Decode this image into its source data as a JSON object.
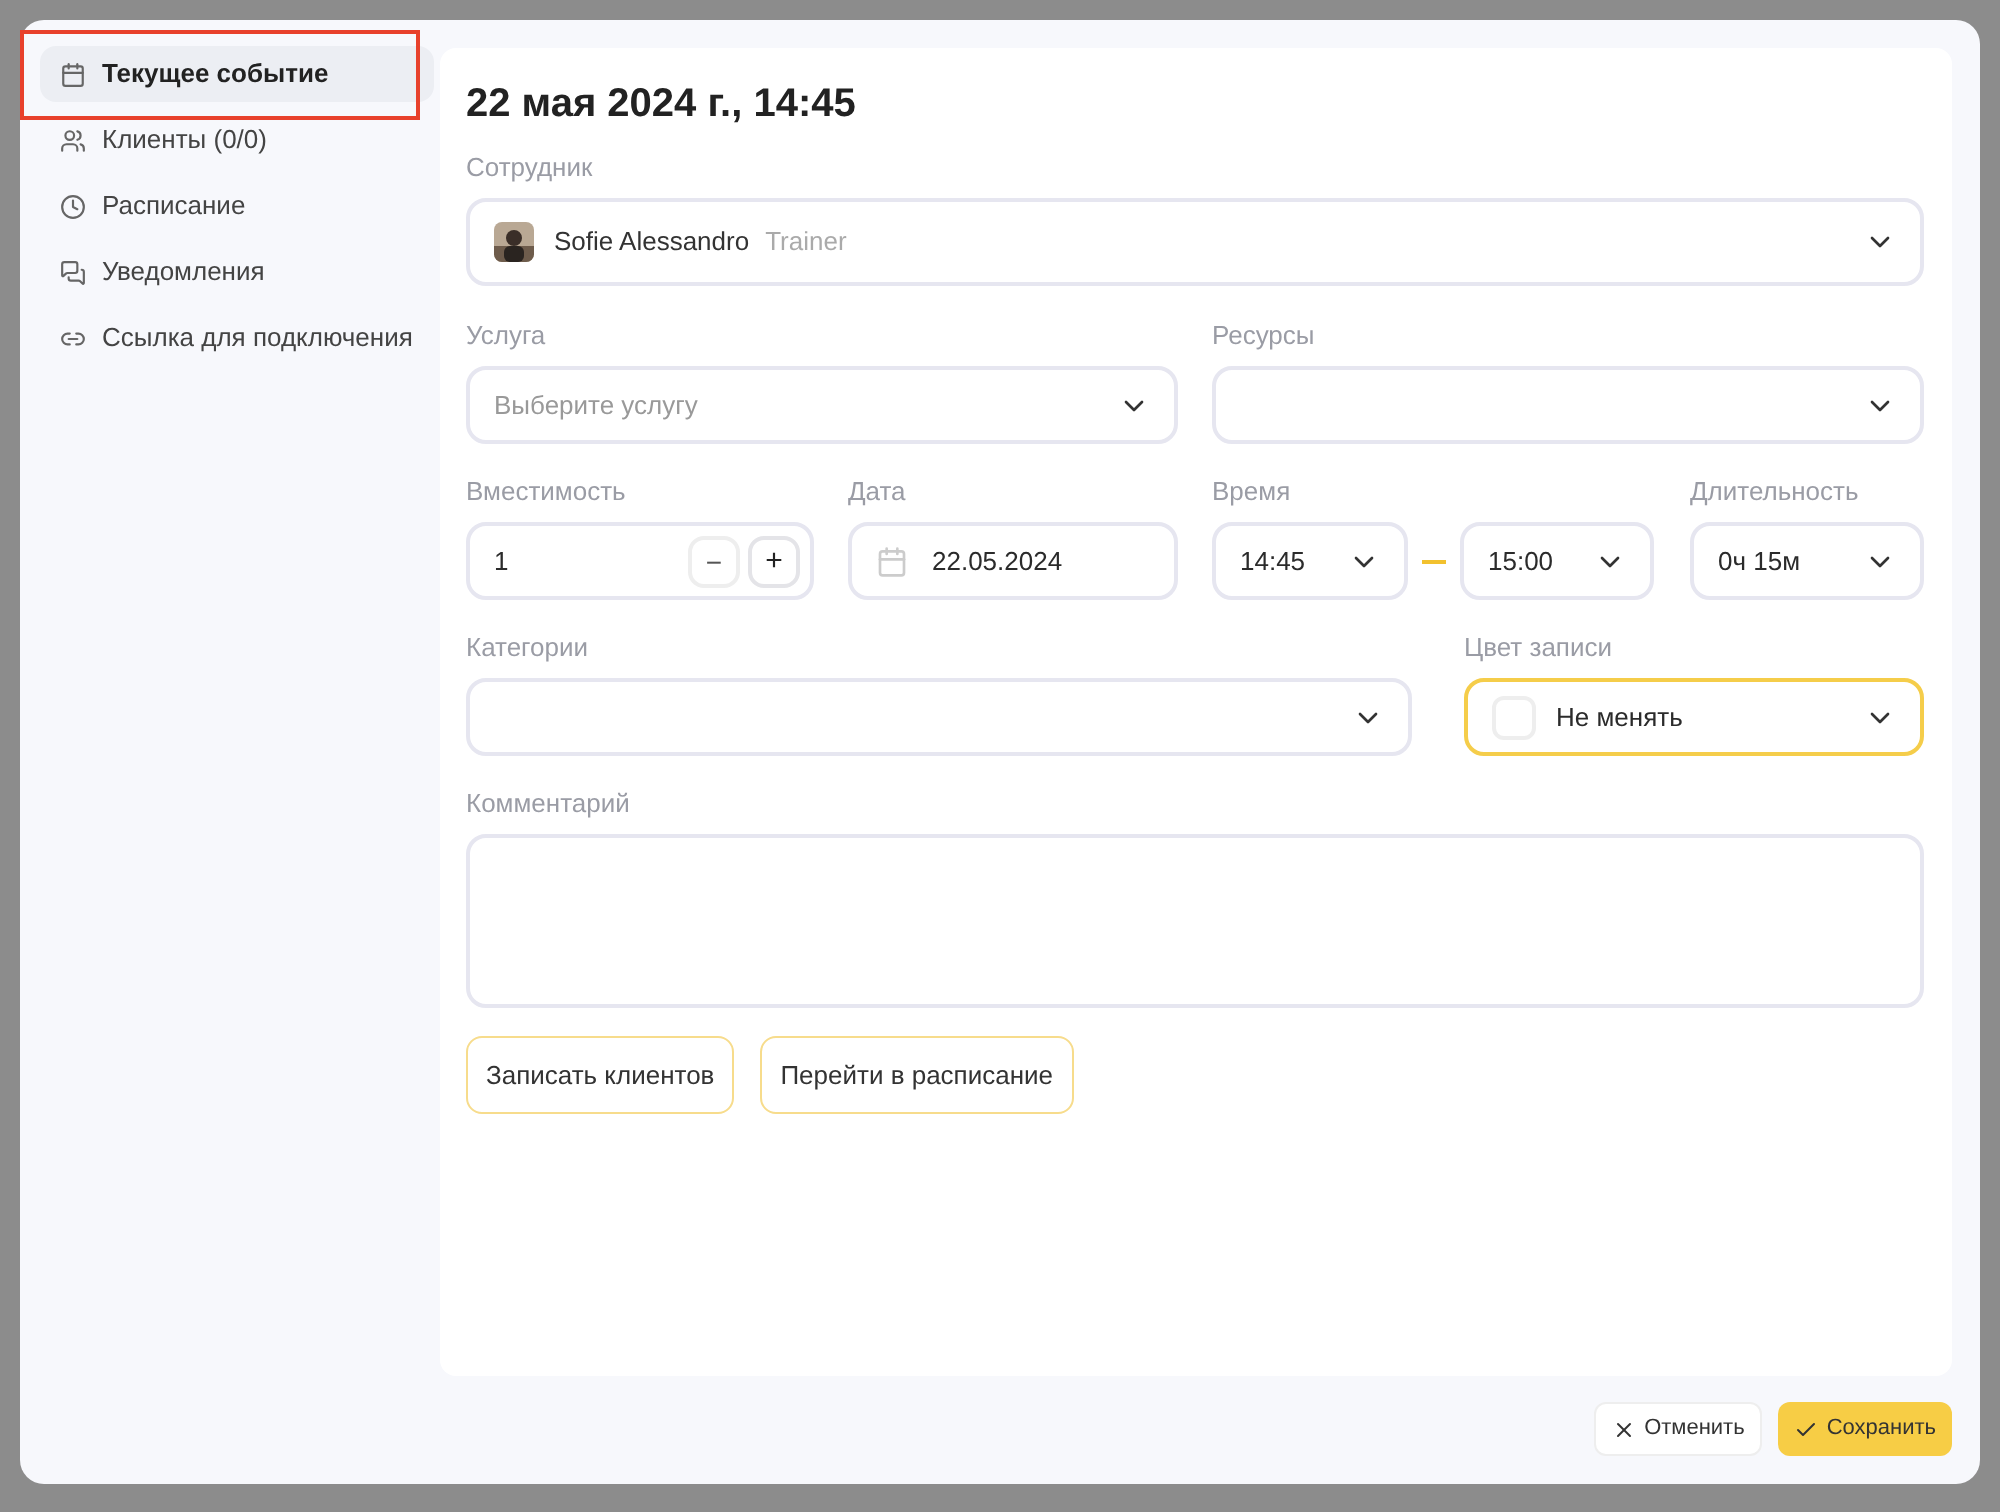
{
  "sidebar": {
    "items": [
      {
        "label": "Текущее событие",
        "selected": true
      },
      {
        "label": "Клиенты (0/0)",
        "selected": false
      },
      {
        "label": "Расписание",
        "selected": false
      },
      {
        "label": "Уведомления",
        "selected": false
      },
      {
        "label": "Ссылка для подключения",
        "selected": false
      }
    ]
  },
  "title": "22 мая 2024 г., 14:45",
  "employee": {
    "label": "Сотрудник",
    "name": "Sofie Alessandro",
    "role": "Trainer"
  },
  "service": {
    "label": "Услуга",
    "placeholder": "Выберите услугу"
  },
  "resources": {
    "label": "Ресурсы"
  },
  "capacity": {
    "label": "Вместимость",
    "value": "1",
    "minus": "−",
    "plus": "+"
  },
  "date": {
    "label": "Дата",
    "value": "22.05.2024"
  },
  "time": {
    "label": "Время",
    "start": "14:45",
    "end": "15:00"
  },
  "duration": {
    "label": "Длительность",
    "value": "0ч 15м"
  },
  "categories": {
    "label": "Категории"
  },
  "record_color": {
    "label": "Цвет записи",
    "value": "Не менять"
  },
  "comment": {
    "label": "Комментарий"
  },
  "actions": [
    "Записать клиентов",
    "Перейти в расписание"
  ],
  "footer": {
    "cancel": "Отменить",
    "save": "Сохранить"
  }
}
